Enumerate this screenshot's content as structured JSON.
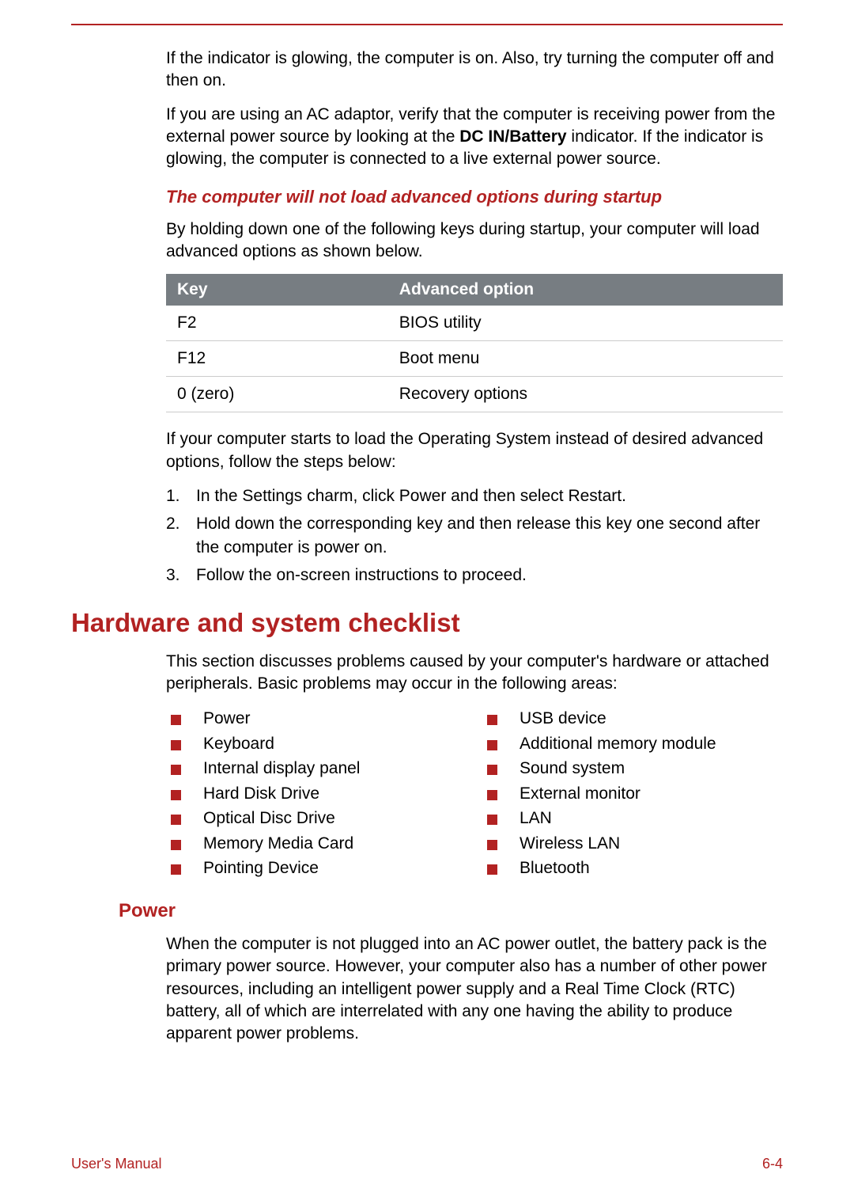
{
  "para1_a": "If the indicator is glowing, the computer is on. Also, try turning the computer off and then on.",
  "para2_pre": "If you are using an AC adaptor, verify that the computer is receiving power from the external power source by looking at the ",
  "para2_bold": "DC IN/Battery",
  "para2_post": " indicator. If the indicator is glowing, the computer is connected to a live external power source.",
  "sub1": "The computer will not load advanced options during startup",
  "para3": "By holding down one of the following keys during startup, your computer will load advanced options as shown below.",
  "table": {
    "h1": "Key",
    "h2": "Advanced option",
    "rows": [
      {
        "k": "F2",
        "v": "BIOS utility"
      },
      {
        "k": "F12",
        "v": "Boot menu"
      },
      {
        "k": "0 (zero)",
        "v": "Recovery options"
      }
    ]
  },
  "para4": "If your computer starts to load the Operating System instead of desired advanced options, follow the steps below:",
  "steps": {
    "s1_pre": "In the ",
    "s1_b1": "Settings",
    "s1_mid": " charm, click ",
    "s1_b2": "Power",
    "s1_mid2": " and then select ",
    "s1_b3": "Restart",
    "s1_post": ".",
    "s2": "Hold down the corresponding key and then release this key one second after the computer is power on.",
    "s3": "Follow the on-screen instructions to proceed."
  },
  "h1": "Hardware and system checklist",
  "para5": "This section discusses problems caused by your computer's hardware or attached peripherals. Basic problems may occur in the following areas:",
  "list_left": [
    "Power",
    "Keyboard",
    "Internal display panel",
    "Hard Disk Drive",
    "Optical Disc Drive",
    "Memory Media Card",
    "Pointing Device"
  ],
  "list_right": [
    "USB device",
    "Additional memory module",
    "Sound system",
    "External monitor",
    "LAN",
    "Wireless LAN",
    "Bluetooth"
  ],
  "sub2": "Power",
  "para6": "When the computer is not plugged into an AC power outlet, the battery pack is the primary power source. However, your computer also has a number of other power resources, including an intelligent power supply and a Real Time Clock (RTC) battery, all of which are interrelated with any one having the ability to produce apparent power problems.",
  "footer_left": "User's Manual",
  "footer_right": "6-4"
}
